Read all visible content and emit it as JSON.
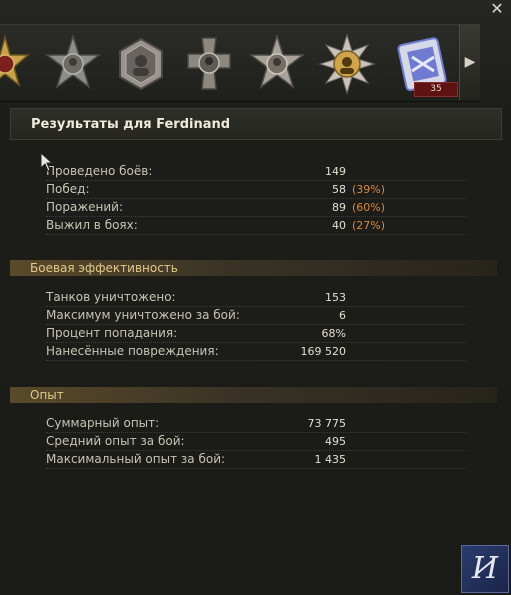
{
  "window": {
    "close_glyph": "✕"
  },
  "medals": [
    {
      "name": "medal-star-cross-icon",
      "color": "#c9a14a"
    },
    {
      "name": "medal-silver-star-icon",
      "color": "#8d8d8a"
    },
    {
      "name": "medal-hexagon-portrait-icon",
      "color": "#9a9490"
    },
    {
      "name": "medal-cross-portrait-icon",
      "color": "#8c8880"
    },
    {
      "name": "medal-star-portrait-icon",
      "color": "#a8a29a"
    },
    {
      "name": "medal-gold-star-icon",
      "color": "#d0a44a"
    },
    {
      "name": "medal-ribbon-badge-icon",
      "color": "#6f7bd0"
    }
  ],
  "medal_strip": {
    "next_arrow": "▶",
    "count": "35"
  },
  "title": "Результаты для Ferdinand",
  "sections": {
    "battles": {
      "rows": [
        {
          "label": "Проведено боёв:",
          "value": "149",
          "percent": ""
        },
        {
          "label": "Побед:",
          "value": "58",
          "percent": "(39%)"
        },
        {
          "label": "Поражений:",
          "value": "89",
          "percent": "(60%)"
        },
        {
          "label": "Выжил в боях:",
          "value": "40",
          "percent": "(27%)"
        }
      ]
    },
    "efficiency": {
      "title": "Боевая эффективность",
      "rows": [
        {
          "label": "Танков уничтожено:",
          "value": "153"
        },
        {
          "label": "Максимум уничтожено за бой:",
          "value": "6"
        },
        {
          "label": "Процент попадания:",
          "value": "68%"
        },
        {
          "label": "Нанесённые повреждения:",
          "value": "169 520"
        }
      ]
    },
    "experience": {
      "title": "Опыт",
      "rows": [
        {
          "label": "Суммарный опыт:",
          "value": "73 775"
        },
        {
          "label": "Средний опыт за бой:",
          "value": "495"
        },
        {
          "label": "Максимальный опыт за бой:",
          "value": "1 435"
        }
      ]
    }
  },
  "logo": {
    "text": "И"
  }
}
